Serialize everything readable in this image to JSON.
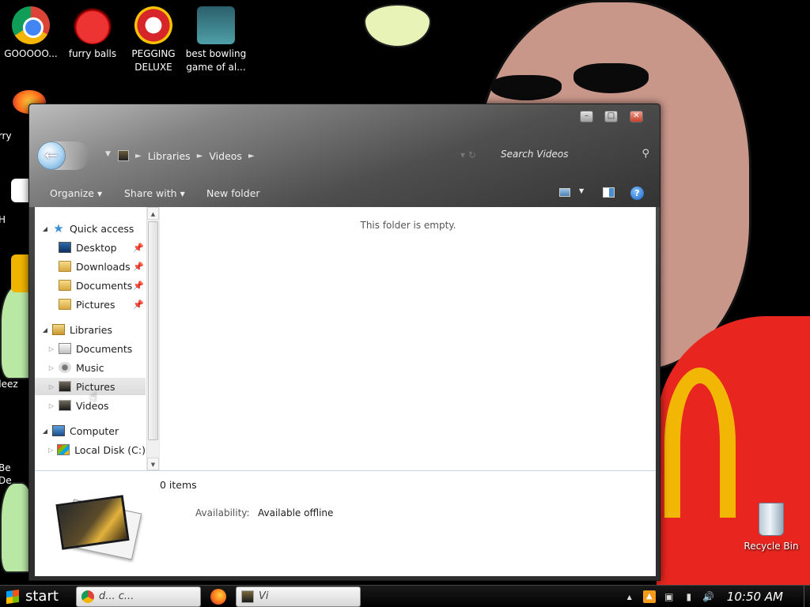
{
  "desktop": {
    "icons": [
      {
        "label": "GOOOOO...",
        "icon": "chrome-icon"
      },
      {
        "label": "furry balls",
        "icon": "furry-balls-icon"
      },
      {
        "label": "PEGGING DELUXE",
        "icon": "pegging-deluxe-icon"
      },
      {
        "label": "best bowling game of al...",
        "icon": "bowling-icon"
      }
    ],
    "partial_labels": {
      "furry": "furry",
      "h": "H",
      "deez": "deez",
      "be": "Be",
      "de": "De"
    },
    "recycle_bin": "Recycle Bin"
  },
  "window": {
    "caption": {
      "minimize": "–",
      "maximize": "□",
      "close": "✕"
    },
    "breadcrumb": [
      "Libraries",
      "Videos"
    ],
    "search_placeholder": "Search Videos",
    "toolbar": {
      "organize": "Organize",
      "share_with": "Share with",
      "new_folder": "New folder",
      "help": "?"
    },
    "nav_tree": {
      "quick_access": "Quick access",
      "quick_items": [
        "Desktop",
        "Downloads",
        "Documents",
        "Pictures"
      ],
      "libraries": "Libraries",
      "library_items": [
        "Documents",
        "Music",
        "Pictures",
        "Videos"
      ],
      "computer": "Computer",
      "computer_items": [
        "Local Disk (C:)"
      ]
    },
    "content": {
      "empty_message": "This folder is empty."
    },
    "details": {
      "item_count": "0 items",
      "availability_label": "Availability:",
      "availability_value": "Available offline"
    }
  },
  "taskbar": {
    "start": "start",
    "buttons": [
      {
        "label": "d... c...",
        "icon": "chrome-icon"
      },
      {
        "label": "Vi",
        "icon": "explorer-icon"
      }
    ],
    "clock": "10:50 AM"
  },
  "colors": {
    "window_frame": "#3c3c3c",
    "glass": "#8c8c8c",
    "accent_blue": "#3d8ed8",
    "taskbar": "#000000"
  }
}
